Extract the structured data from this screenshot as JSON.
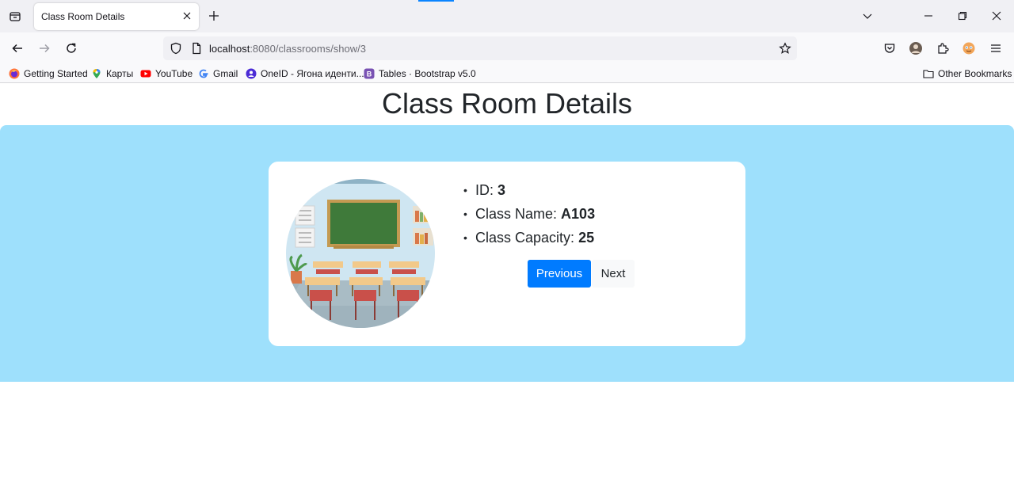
{
  "browser": {
    "tab_title": "Class Room Details",
    "url_host": "localhost",
    "url_path": ":8080/classrooms/show/3",
    "bookmarks": [
      {
        "label": "Getting Started",
        "icon": "firefox-icon"
      },
      {
        "label": "Карты",
        "icon": "maps-pin-icon"
      },
      {
        "label": "YouTube",
        "icon": "youtube-icon"
      },
      {
        "label": "Gmail",
        "icon": "google-icon"
      },
      {
        "label": "OneID - Ягона иденти...",
        "icon": "oneid-icon"
      },
      {
        "label": "Tables · Bootstrap v5.0",
        "icon": "bootstrap-icon"
      }
    ],
    "other_bookmarks": "Other Bookmarks"
  },
  "page": {
    "title": "Class Room Details",
    "classroom": {
      "id_label": "ID:",
      "id_value": "3",
      "name_label": "Class Name:",
      "name_value": "A103",
      "capacity_label": "Class Capacity:",
      "capacity_value": "25"
    },
    "buttons": {
      "previous": "Previous",
      "next": "Next"
    }
  },
  "colors": {
    "band_bg": "#9ee0fc",
    "primary": "#007bff",
    "accent": "#0a84ff"
  }
}
